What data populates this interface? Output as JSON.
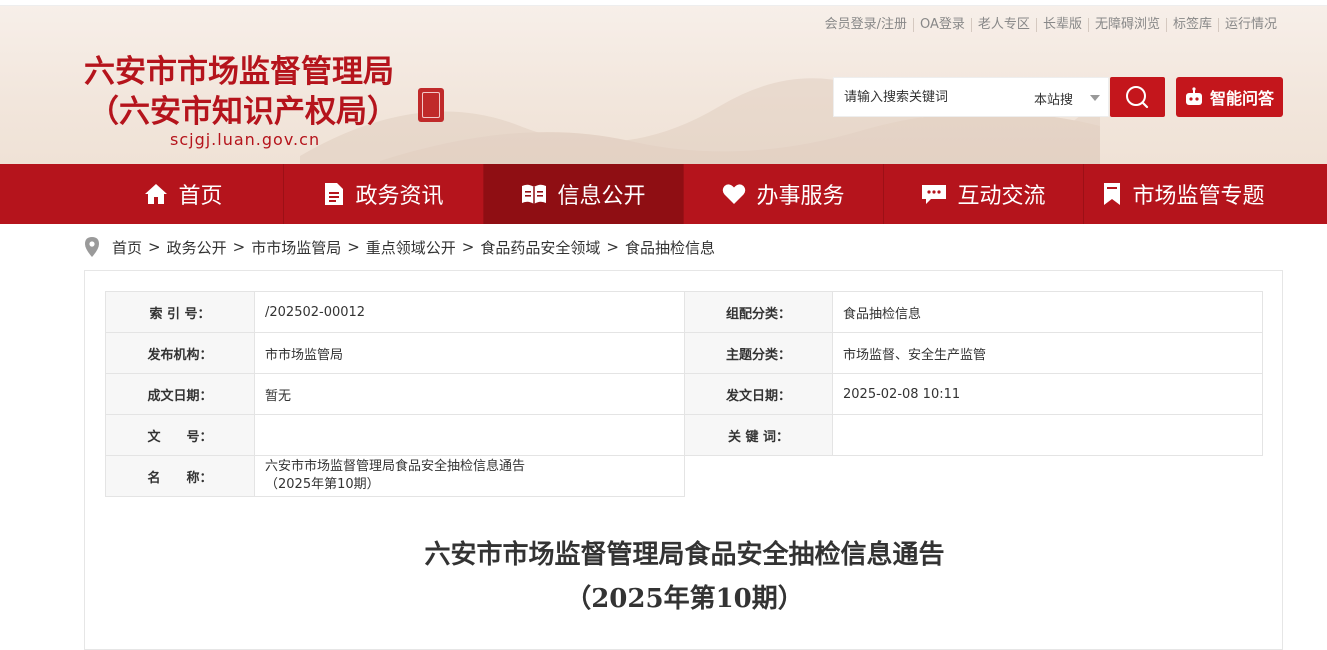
{
  "header": {
    "title_line1": "六安市市场监督管理局",
    "title_line2": "（六安市知识产权局）",
    "url": "scjgj.luan.gov.cn",
    "brand_color": "#b5141c"
  },
  "top_links": [
    "会员登录/注册",
    "OA登录",
    "老人专区",
    "长辈版",
    "无障碍浏览",
    "标签库",
    "运行情况"
  ],
  "search": {
    "placeholder": "请输入搜索关键词",
    "scope": "本站搜",
    "button_icon": "search-icon",
    "ai_label": "智能问答",
    "ai_icon": "robot-icon"
  },
  "nav": {
    "items": [
      {
        "label": "首页",
        "icon": "home-icon"
      },
      {
        "label": "政务资讯",
        "icon": "document-icon"
      },
      {
        "label": "信息公开",
        "icon": "open-book-icon"
      },
      {
        "label": "办事服务",
        "icon": "heart-icon"
      },
      {
        "label": "互动交流",
        "icon": "chat-icon"
      },
      {
        "label": "市场监管专题",
        "icon": "bookmark-icon"
      }
    ],
    "active_index": 2
  },
  "breadcrumb": [
    "首页",
    "政务公开",
    "市市场监管局",
    "重点领域公开",
    "食品药品安全领域",
    "食品抽检信息"
  ],
  "meta": {
    "index_label": "索 引 号：",
    "index_value": "/202502-00012",
    "category_label": "组配分类：",
    "category_value": "食品抽检信息",
    "publisher_label": "发布机构：",
    "publisher_value": "市市场监管局",
    "topic_label": "主题分类：",
    "topic_value": "市场监督、安全生产监管",
    "created_label": "成文日期：",
    "created_value": "暂无",
    "issued_label": "发文日期：",
    "issued_value": "2025-02-08 10:11",
    "docno_label": "文　　号：",
    "docno_value": "",
    "keywords_label": "关 键 词：",
    "keywords_value": "",
    "name_label": "名　　称：",
    "name_value_line1": "六安市市场监督管理局食品安全抽检信息通告",
    "name_value_line2": "（2025年第10期）"
  },
  "document": {
    "title_line1": "六安市市场监督管理局食品安全抽检信息通告",
    "title_line2": "（2025年第10期）"
  }
}
